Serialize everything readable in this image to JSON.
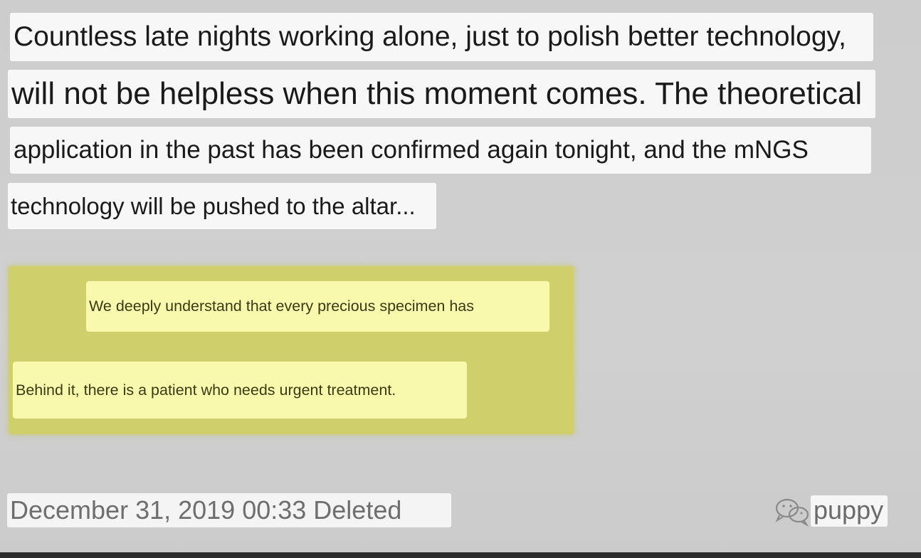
{
  "caption_lines": [
    "Countless late nights working alone, just to polish better technology,",
    "will not be helpless when this moment comes. The theoretical",
    "application in the past has been confirmed again tonight, and the mNGS",
    "technology will be pushed to the altar..."
  ],
  "notes": [
    "We deeply understand that every precious specimen has",
    "Behind it, there is a patient who needs urgent treatment."
  ],
  "footer": {
    "date_status": "December 31, 2019 00:33 Deleted",
    "watermark_text": "puppy",
    "watermark_icon": "wechat-icon"
  },
  "colors": {
    "background": "#cfcfcf",
    "caption_box": "#f7f7f7",
    "highlight_panel": "#cfcf6c",
    "note_box": "#f9f9ad"
  }
}
